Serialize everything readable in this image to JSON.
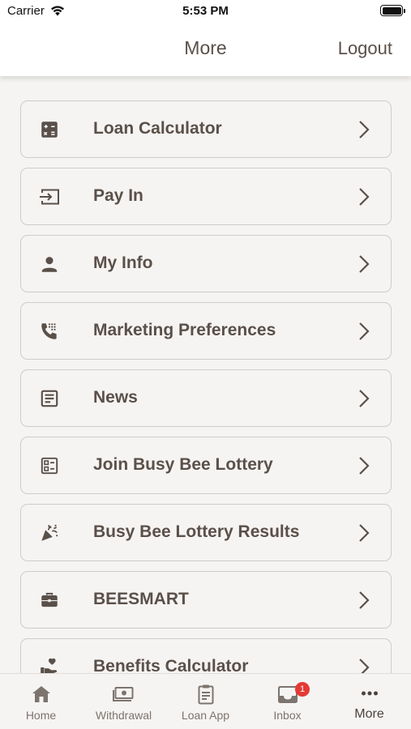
{
  "status_bar": {
    "carrier": "Carrier",
    "time": "5:53 PM"
  },
  "header": {
    "title": "More",
    "logout_label": "Logout"
  },
  "menu": {
    "items": [
      {
        "label": "Loan Calculator",
        "icon": "calculator-icon"
      },
      {
        "label": "Pay In",
        "icon": "login-arrow-icon"
      },
      {
        "label": "My Info",
        "icon": "person-icon"
      },
      {
        "label": "Marketing Preferences",
        "icon": "phone-dialpad-icon"
      },
      {
        "label": "News",
        "icon": "article-icon"
      },
      {
        "label": "Join Busy Bee Lottery",
        "icon": "ticket-list-icon"
      },
      {
        "label": "Busy Bee Lottery Results",
        "icon": "celebration-icon"
      },
      {
        "label": "BEESMART",
        "icon": "briefcase-icon"
      },
      {
        "label": "Benefits Calculator",
        "icon": "hand-heart-icon"
      }
    ]
  },
  "tabbar": {
    "tabs": [
      {
        "label": "Home",
        "icon": "home-icon"
      },
      {
        "label": "Withdrawal",
        "icon": "cash-icon"
      },
      {
        "label": "Loan App",
        "icon": "clipboard-icon"
      },
      {
        "label": "Inbox",
        "icon": "inbox-icon",
        "badge": "1"
      },
      {
        "label": "More",
        "icon": "more-dots-icon"
      }
    ],
    "active": "More"
  },
  "colors": {
    "text": "#5a504a",
    "border": "#cfcbc8",
    "background": "#f6f4f2",
    "badge": "#e53935"
  }
}
